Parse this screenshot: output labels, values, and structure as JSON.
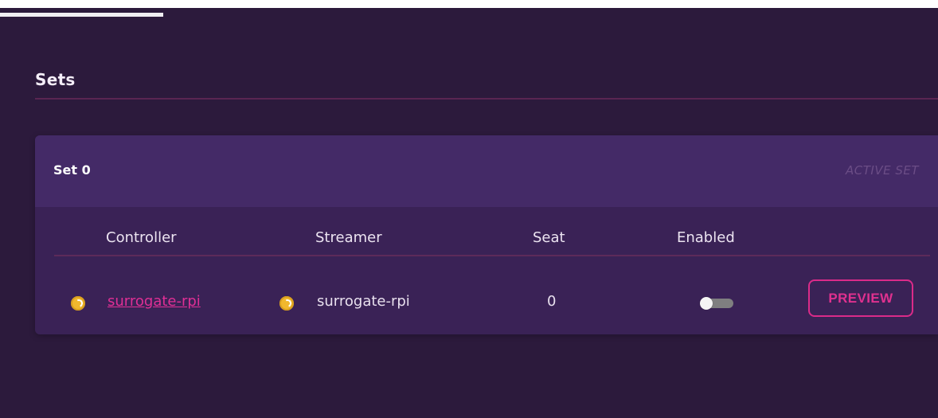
{
  "page": {
    "section_title": "Sets"
  },
  "set": {
    "title": "Set 0",
    "status_label": "ACTIVE SET"
  },
  "table": {
    "columns": {
      "controller": "Controller",
      "streamer": "Streamer",
      "seat": "Seat",
      "enabled": "Enabled"
    },
    "row": {
      "controller": "surrogate-rpi",
      "streamer": "surrogate-rpi",
      "seat": "0",
      "enabled": false,
      "action_label": "PREVIEW"
    }
  },
  "icons": {
    "status": "status-icon",
    "toggle": "toggle-switch-icon"
  },
  "colors": {
    "background": "#2c1a3c",
    "card": "#3a2256",
    "card_header": "#442a67",
    "accent": "#e0318f",
    "status": "#f1b82e",
    "text": "#e8e0ee"
  }
}
